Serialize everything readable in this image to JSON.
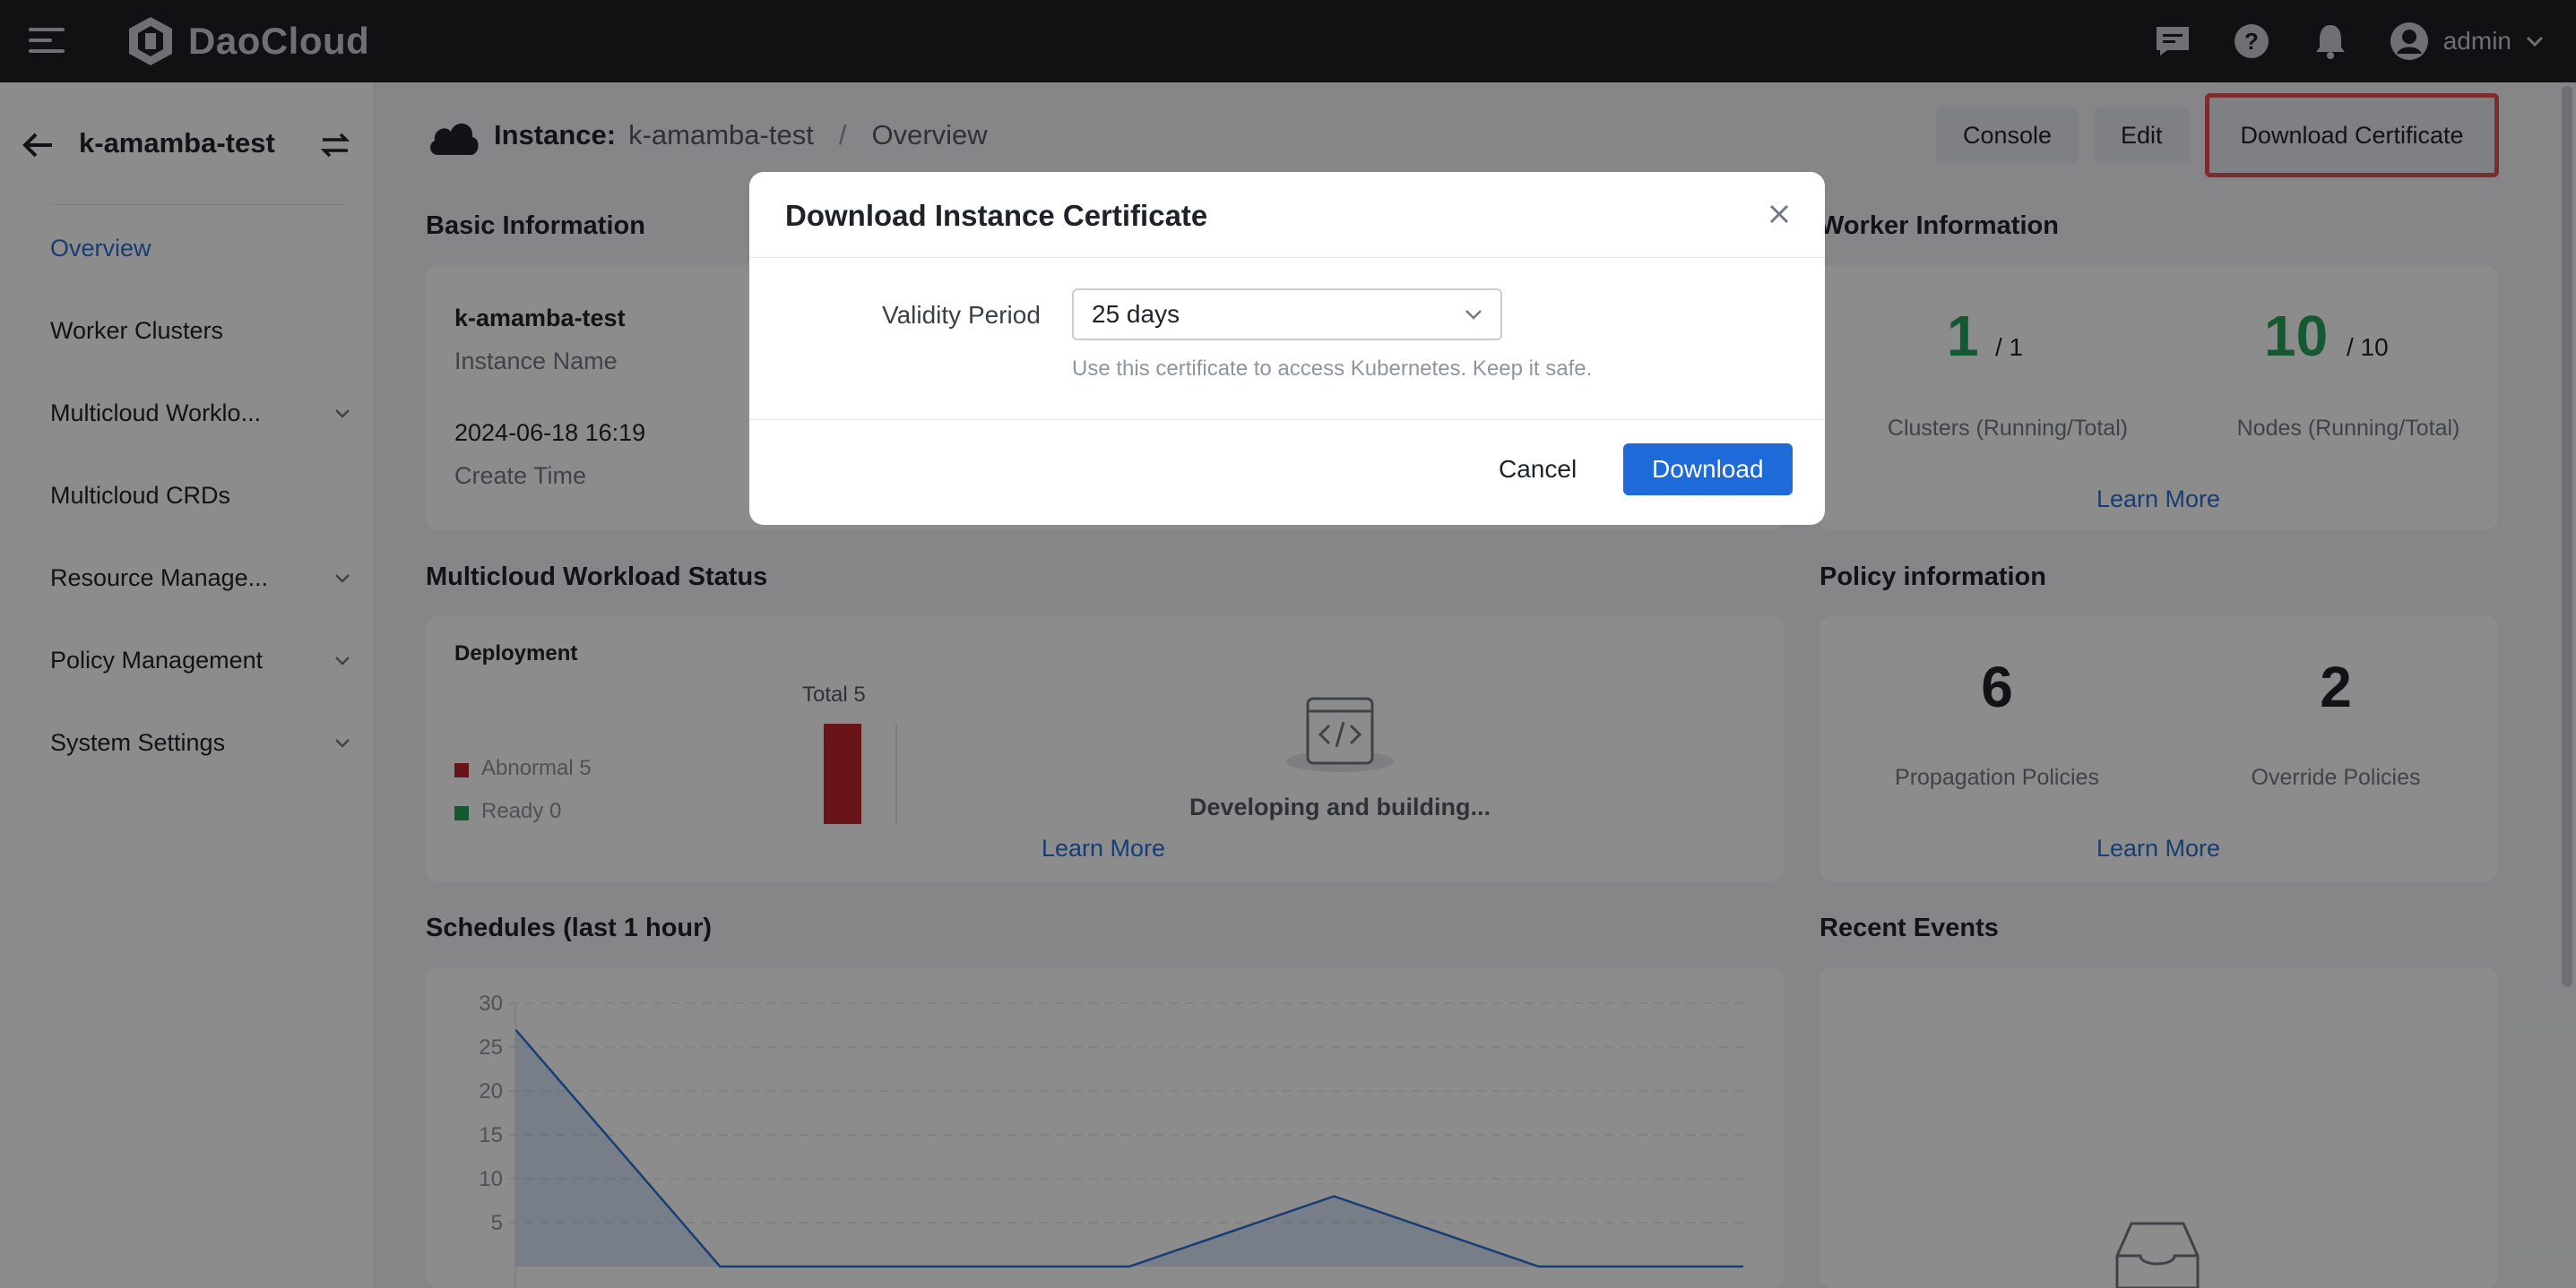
{
  "app": {
    "brand": "DaoCloud",
    "user": "admin"
  },
  "sidebar": {
    "title": "k-amamba-test",
    "items": [
      {
        "label": "Overview",
        "active": true
      },
      {
        "label": "Worker Clusters"
      },
      {
        "label": "Multicloud Worklo..."
      },
      {
        "label": "Multicloud CRDs"
      },
      {
        "label": "Resource Manage..."
      },
      {
        "label": "Policy Management"
      },
      {
        "label": "System Settings"
      }
    ]
  },
  "header": {
    "label": "Instance:",
    "instance": "k-amamba-test",
    "separator": "/",
    "page": "Overview",
    "buttons": {
      "console": "Console",
      "edit": "Edit",
      "download_cert": "Download Certificate"
    }
  },
  "basic_info": {
    "title": "Basic Information",
    "name_value": "k-amamba-test",
    "name_label": "Instance Name",
    "time_value": "2024-06-18 16:19",
    "time_label": "Create Time"
  },
  "worker_info": {
    "title": "Worker Information",
    "clusters_running": "1",
    "clusters_total": "/ 1",
    "clusters_label": "Clusters (Running/Total)",
    "nodes_running": "10",
    "nodes_total": "/ 10",
    "nodes_label": "Nodes (Running/Total)",
    "learn_more": "Learn More"
  },
  "workload_status": {
    "title": "Multicloud Workload Status",
    "deployment_label": "Deployment",
    "total": "Total 5",
    "abnormal": "Abnormal 5",
    "ready": "Ready 0",
    "developing": "Developing and building...",
    "learn_more": "Learn More",
    "colors": {
      "abnormal": "#c0262e",
      "ready": "#25a35a"
    }
  },
  "policy_info": {
    "title": "Policy information",
    "propagation_count": "6",
    "propagation_label": "Propagation Policies",
    "override_count": "2",
    "override_label": "Override Policies",
    "learn_more": "Learn More"
  },
  "schedules": {
    "title": "Schedules (last 1 hour)",
    "y_ticks": [
      "30",
      "25",
      "20",
      "15",
      "10",
      "5"
    ]
  },
  "recent_events": {
    "title": "Recent Events"
  },
  "chart_data": {
    "type": "line",
    "title": "Schedules (last 1 hour)",
    "ylim": [
      0,
      30
    ],
    "x": [
      0,
      1,
      2,
      3,
      4,
      5,
      6
    ],
    "series": [
      {
        "values": [
          27,
          0,
          0,
          0,
          8,
          0,
          0
        ]
      }
    ],
    "grid": true
  },
  "modal": {
    "title": "Download Instance Certificate",
    "field_label": "Validity Period",
    "select_value": "25 days",
    "hint": "Use this certificate to access Kubernetes. Keep it safe.",
    "cancel": "Cancel",
    "download": "Download"
  }
}
